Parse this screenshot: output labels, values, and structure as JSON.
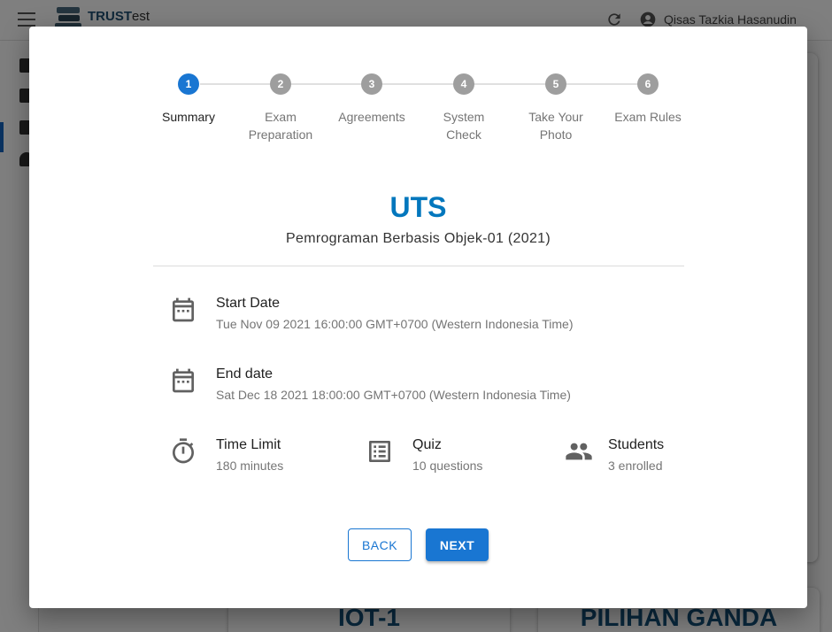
{
  "app": {
    "brand_strong": "TRUST",
    "brand_light": "est",
    "user_name": "Qisas Tazkia Hasanudin"
  },
  "background_cards": [
    "IOT-1",
    "PILIHAN GANDA"
  ],
  "stepper": {
    "active_step": 1,
    "steps": [
      {
        "number": "1",
        "label": "Summary"
      },
      {
        "number": "2",
        "label": "Exam Preparation"
      },
      {
        "number": "3",
        "label": "Agreements"
      },
      {
        "number": "4",
        "label": "System Check"
      },
      {
        "number": "5",
        "label": "Take Your Photo"
      },
      {
        "number": "6",
        "label": "Exam Rules"
      }
    ]
  },
  "exam": {
    "title": "UTS",
    "subtitle": "Pemrograman Berbasis Objek-01 (2021)"
  },
  "details": {
    "start_date": {
      "label": "Start Date",
      "value": "Tue Nov 09 2021 16:00:00 GMT+0700 (Western Indonesia Time)"
    },
    "end_date": {
      "label": "End date",
      "value": "Sat Dec 18 2021 18:00:00 GMT+0700 (Western Indonesia Time)"
    },
    "time_limit": {
      "label": "Time Limit",
      "value": "180 minutes"
    },
    "quiz": {
      "label": "Quiz",
      "value": "10 questions"
    },
    "students": {
      "label": "Students",
      "value": "3 enrolled"
    }
  },
  "actions": {
    "back_label": "BACK",
    "next_label": "NEXT"
  },
  "colors": {
    "accent": "#1976d2",
    "title": "#0277bd",
    "inactive_step": "#9e9e9e"
  }
}
